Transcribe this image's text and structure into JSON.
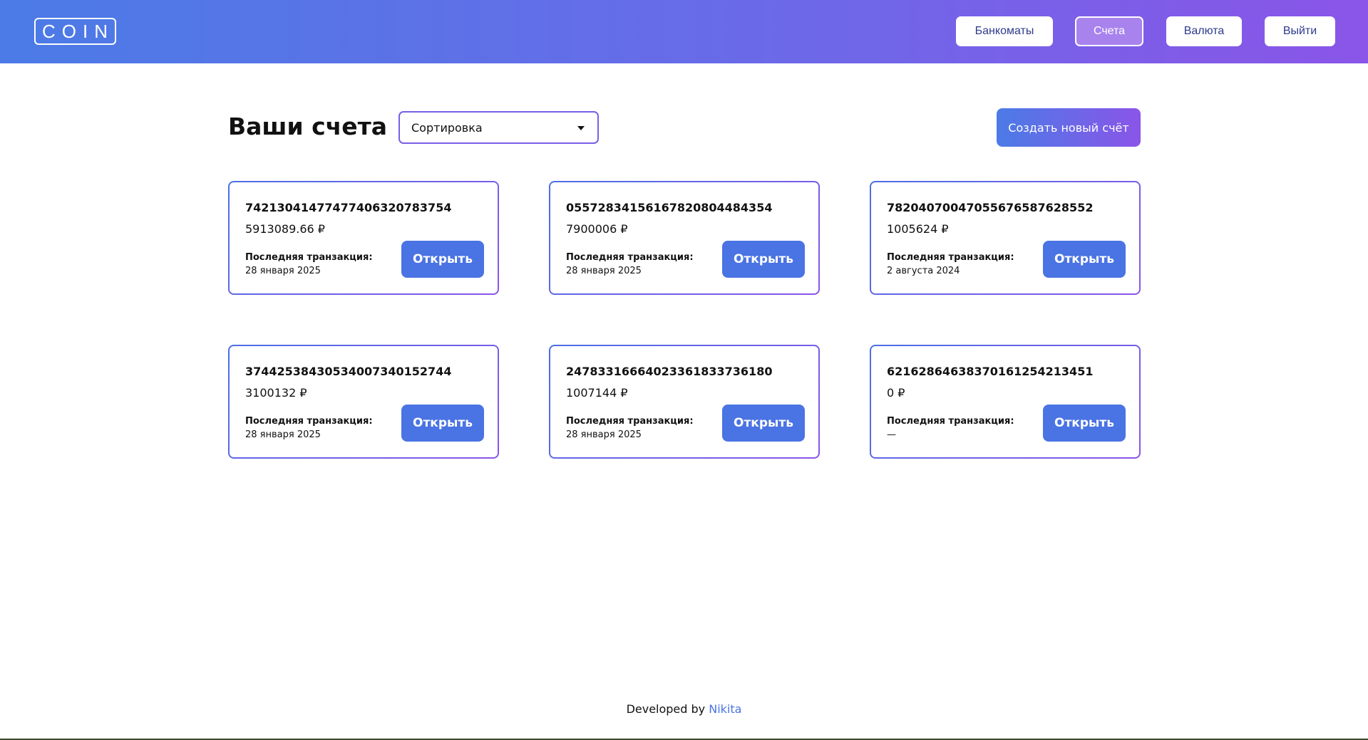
{
  "header": {
    "logo": "COIN",
    "nav": {
      "atm": "Банкоматы",
      "accounts": "Счета",
      "currency": "Валюта",
      "logout": "Выйти"
    }
  },
  "toolbar": {
    "title": "Ваши счета",
    "sort_value": "Сортировка",
    "create_label": "Создать новый счёт"
  },
  "accounts": [
    {
      "number": "74213041477477406320783754",
      "balance": "5913089.66 ₽",
      "tx_label": "Последняя транзакция:",
      "tx_date": "28 января 2025",
      "open_label": "Открыть"
    },
    {
      "number": "05572834156167820804484354",
      "balance": "7900006 ₽",
      "tx_label": "Последняя транзакция:",
      "tx_date": "28 января 2025",
      "open_label": "Открыть"
    },
    {
      "number": "78204070047055676587628552",
      "balance": "1005624 ₽",
      "tx_label": "Последняя транзакция:",
      "tx_date": "2 августа 2024",
      "open_label": "Открыть"
    },
    {
      "number": "37442538430534007340152744",
      "balance": "3100132 ₽",
      "tx_label": "Последняя транзакция:",
      "tx_date": "28 января 2025",
      "open_label": "Открыть"
    },
    {
      "number": "24783316664023361833736180",
      "balance": "1007144 ₽",
      "tx_label": "Последняя транзакция:",
      "tx_date": "28 января 2025",
      "open_label": "Открыть"
    },
    {
      "number": "62162864638370161254213451",
      "balance": "0 ₽",
      "tx_label": "Последняя транзакция:",
      "tx_date": "—",
      "open_label": "Открыть"
    }
  ],
  "footer": {
    "prefix": "Developed by",
    "author": "Nikita"
  }
}
